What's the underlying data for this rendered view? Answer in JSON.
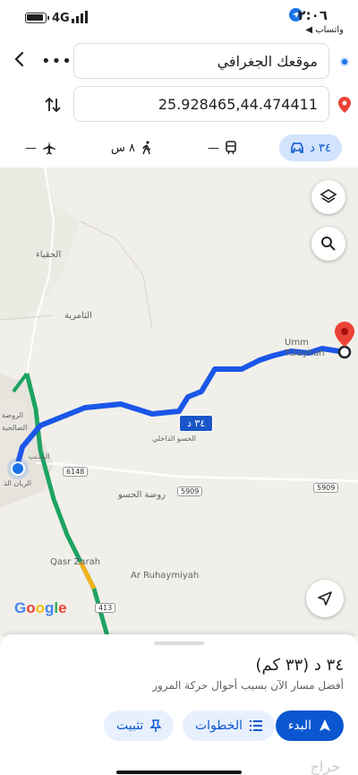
{
  "status_bar": {
    "time": "٢:٠٦",
    "back_app": "◀ واتساب",
    "network": "4G"
  },
  "directions": {
    "origin": "موقعك الجغرافي",
    "destination": "25.928465,44.474411",
    "more_label": "•••"
  },
  "modes": [
    {
      "name": "drive",
      "label": "٣٤ د",
      "active": true
    },
    {
      "name": "transit",
      "label": "—"
    },
    {
      "name": "walk",
      "label": "٨ س"
    },
    {
      "name": "flight",
      "label": "—"
    }
  ],
  "map": {
    "labels": {
      "alhaba": "الحقباء",
      "thamiriya": "الثامرية",
      "umm_tulayhah": "Umm\nTulayhah",
      "hisw_dakhli": "الحسو الداخلي",
      "rawdat_hisw": "روضة الحسو",
      "qasr_zarah": "Qasr Zarah",
      "ruhaymiyah": "Ar Ruhaymiyah",
      "almadhnab": "المذنب",
      "rawda": "الروضة",
      "alsalihiya": "الصالحية",
      "alrayyan": "الريان الذ"
    },
    "shields": {
      "r6148": "6148",
      "r5909a": "5909",
      "r5909b": "5909",
      "r413": "413"
    },
    "route_duration": "٣٤ د",
    "google": "Google",
    "colors": {
      "route": "#1a56e8",
      "highway": "#1ea362",
      "pin": "#ea4335"
    }
  },
  "sheet": {
    "summary": "٣٤ د  (٣٣ كم)",
    "note": "أفضل مسار الآن بسبب أحوال حركة المرور",
    "start_label": "البدء",
    "steps_label": "الخطوات",
    "pin_label": "تثبيت",
    "watermark": "حراج"
  }
}
